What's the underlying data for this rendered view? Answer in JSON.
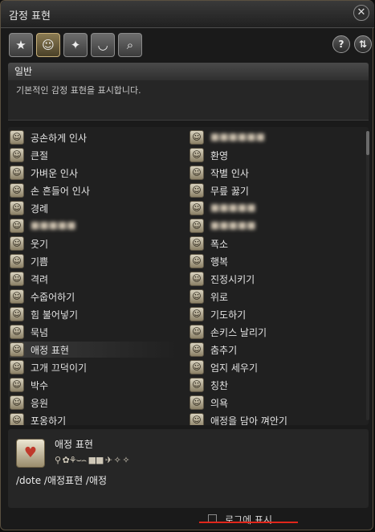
{
  "window": {
    "title": "감정 표현",
    "close_icon": "close-x-icon"
  },
  "categories": [
    {
      "id": "favorites",
      "icon": "star-icon",
      "glyph": "★",
      "active": false
    },
    {
      "id": "general",
      "icon": "person-bow-icon",
      "glyph": "☺",
      "active": true
    },
    {
      "id": "special",
      "icon": "dancer-icon",
      "glyph": "✦",
      "active": false
    },
    {
      "id": "expressions",
      "icon": "smiley-icon",
      "glyph": "◡",
      "active": false
    },
    {
      "id": "search",
      "icon": "magnifier-icon",
      "glyph": "⌕",
      "active": false
    }
  ],
  "toolbar": {
    "help_label": "?",
    "sort_label": "⇅"
  },
  "section": {
    "title": "일반",
    "description": "기본적인 감정 표현을 표시합니다."
  },
  "left_column": [
    "공손하게 인사",
    "큰절",
    "가벼운 인사",
    "손 흔들어 인사",
    "경례",
    "■■■■■",
    "웃기",
    "기쁨",
    "격려",
    "수줍어하기",
    "힘 불어넣기",
    "묵념",
    "애정 표현",
    "고개 끄덕이기",
    "박수",
    "응원",
    "포옹하기"
  ],
  "right_column": [
    "■■■■■■",
    "환영",
    "작별 인사",
    "무릎 꿇기",
    "■■■■■",
    "■■■■■",
    "폭소",
    "행복",
    "진정시키기",
    "위로",
    "기도하기",
    "손키스 날리기",
    "춤추기",
    "엄지 세우기",
    "칭찬",
    "의욕",
    "애정을 담아 껴안기"
  ],
  "selected_index": 12,
  "detail": {
    "name": "애정 표현",
    "preview": "⚲ ✿⚘⌣⌢ ■■ ✈ ✧ ✧",
    "commands": "/dote  /애정표현 /애정",
    "icon": "heart-pose-icon"
  },
  "log_toggle": {
    "label": "로그에 표시",
    "checked": false
  },
  "colors": {
    "accent": "#e0261b",
    "selected_border": "#c8b07a"
  }
}
